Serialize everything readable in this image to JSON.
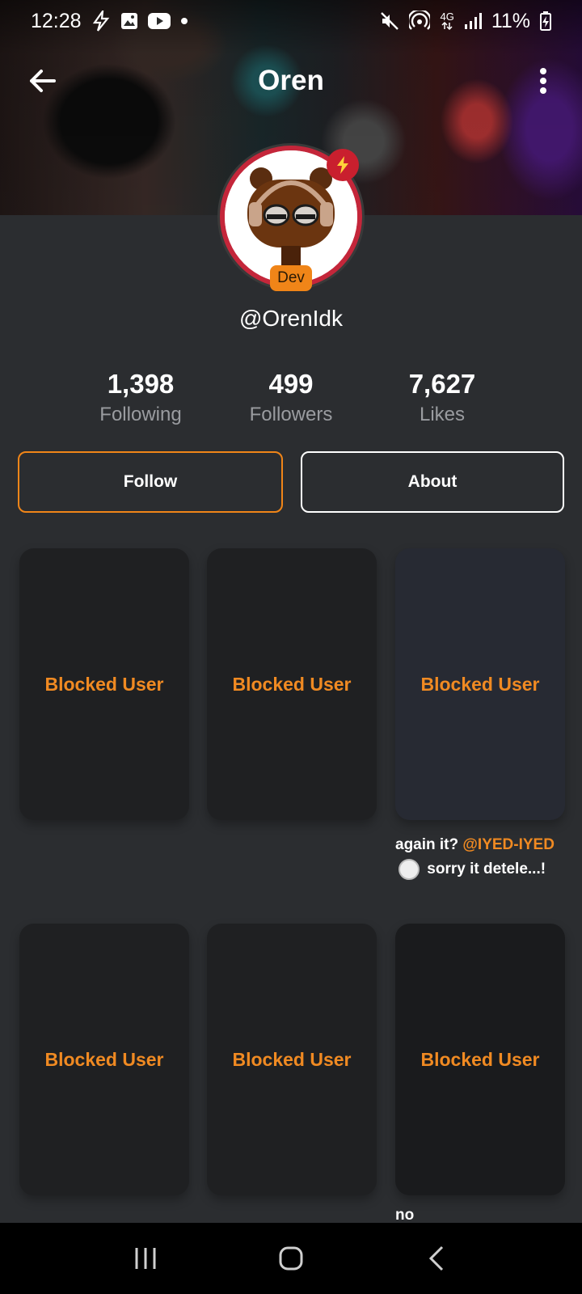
{
  "status_bar": {
    "time": "12:28",
    "battery": "11%",
    "network": "4G"
  },
  "header": {
    "title": "Oren"
  },
  "profile": {
    "badge": "Dev",
    "username": "@OrenIdk"
  },
  "stats": [
    {
      "value": "1,398",
      "label": "Following"
    },
    {
      "value": "499",
      "label": "Followers"
    },
    {
      "value": "7,627",
      "label": "Likes"
    }
  ],
  "actions": {
    "follow_label": "Follow",
    "about_label": "About"
  },
  "posts": [
    {
      "label": "Blocked User"
    },
    {
      "label": "Blocked User"
    },
    {
      "label": "Blocked User"
    },
    {
      "label": "Blocked User"
    },
    {
      "label": "Blocked User"
    },
    {
      "label": "Blocked User"
    }
  ],
  "post_caption": {
    "text_before": "again it? ",
    "mention": "@IYED-IYED",
    "text_after": " sorry it detele...!"
  },
  "post_caption_2": "no",
  "colors": {
    "accent": "#f08518",
    "background": "#2b2d30",
    "avatar_ring": "#c4263a"
  }
}
